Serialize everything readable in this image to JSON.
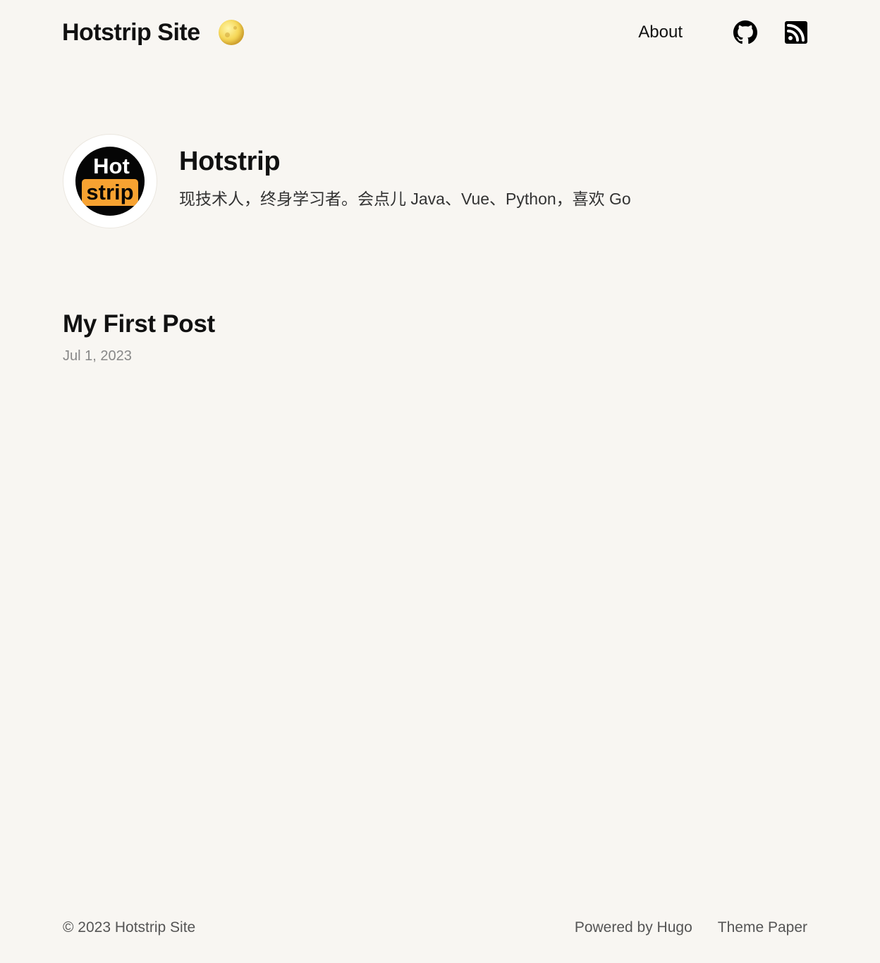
{
  "header": {
    "site_title": "Hotstrip Site",
    "theme_toggle_icon": "moon-icon",
    "nav": {
      "about_label": "About",
      "github_icon": "github-icon",
      "rss_icon": "rss-icon"
    }
  },
  "profile": {
    "avatar": {
      "line1": "Hot",
      "line2": "strip",
      "accent_color": "#f7a231"
    },
    "name": "Hotstrip",
    "bio": "现技术人，终身学习者。会点儿 Java、Vue、Python，喜欢 Go"
  },
  "posts": [
    {
      "title": "My First Post",
      "date": "Jul 1, 2023"
    }
  ],
  "footer": {
    "copyright": "© 2023 Hotstrip Site",
    "powered_by": "Powered by Hugo",
    "theme": "Theme Paper"
  },
  "colors": {
    "background": "#f8f6f2",
    "text": "#111111",
    "muted": "#888888"
  }
}
